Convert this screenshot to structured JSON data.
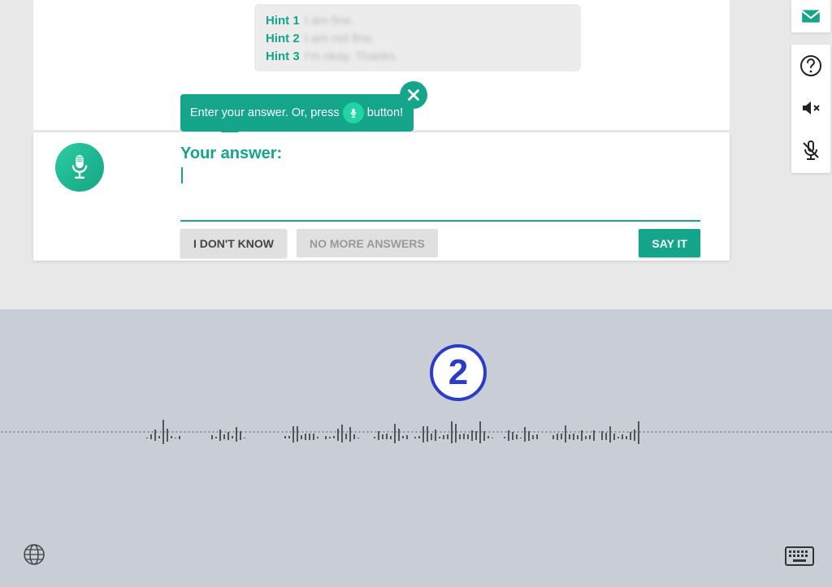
{
  "colors": {
    "accent": "#14a58a",
    "accent_light": "#22d3a6",
    "badge_blue": "#2a3cc8"
  },
  "hints": [
    {
      "label": "Hint 1",
      "text": "I am fine."
    },
    {
      "label": "Hint 2",
      "text": "I am not fine."
    },
    {
      "label": "Hint 3",
      "text": "I'm okay. Thanks."
    }
  ],
  "tooltip": {
    "pre": "Enter your answer. Or, press",
    "post": "button!",
    "close_icon": "close-icon"
  },
  "answer": {
    "title": "Your answer:",
    "value": ""
  },
  "buttons": {
    "idk": "I DON'T KNOW",
    "nma": "NO MORE ANSWERS",
    "say": "SAY IT"
  },
  "rail": {
    "email_icon": "email-icon",
    "help_icon": "help-icon",
    "mute_icon": "speaker-muted-icon",
    "mic_off_icon": "microphone-off-icon"
  },
  "wave": {
    "badge_number": "2"
  },
  "footer": {
    "globe_icon": "globe-icon",
    "keyboard_icon": "keyboard-icon"
  }
}
